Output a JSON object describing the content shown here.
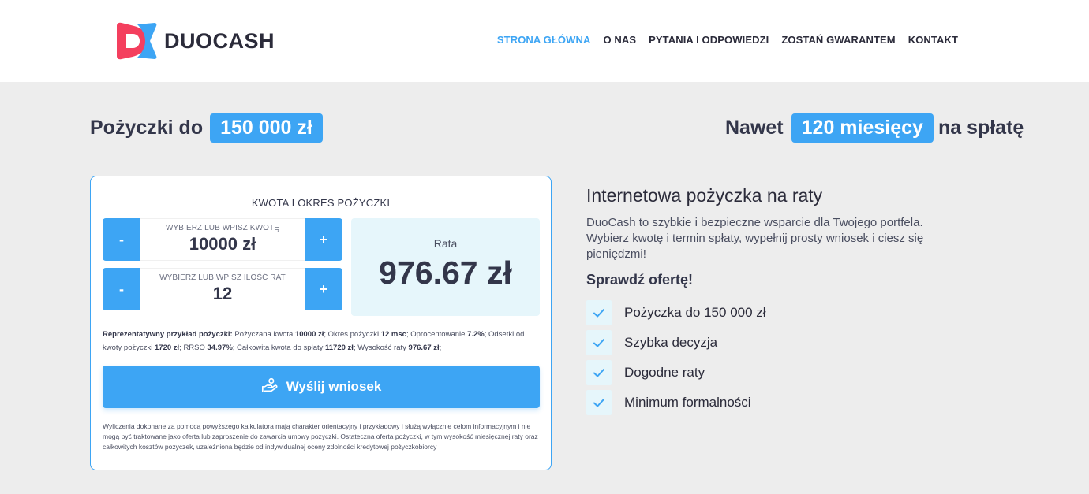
{
  "brand": {
    "name": "DUOCASH",
    "colors": {
      "accent": "#3da5f4",
      "logo_red": "#f43f5e",
      "logo_blue": "#3da5f4"
    }
  },
  "nav": {
    "items": [
      {
        "label": "STRONA GŁÓWNA",
        "active": true
      },
      {
        "label": "O NAS"
      },
      {
        "label": "PYTANIA I ODPOWIEDZI"
      },
      {
        "label": "ZOSTAŃ GWARANTEM"
      },
      {
        "label": "KONTAKT"
      }
    ]
  },
  "headline_left": {
    "prefix": "Pożyczki do",
    "highlight": "150 000 zł"
  },
  "headline_right": {
    "prefix": "Nawet",
    "highlight": "120 miesięcy",
    "suffix": "na spłatę"
  },
  "calculator": {
    "title": "KWOTA I OKRES POŻYCZKI",
    "amount": {
      "label": "WYBIERZ LUB WPISZ KWOTĘ",
      "value": "10000 zł",
      "minus": "-",
      "plus": "+"
    },
    "installments": {
      "label": "WYBIERZ LUB WPISZ ILOŚĆ RAT",
      "value": "12",
      "minus": "-",
      "plus": "+"
    },
    "rate": {
      "label": "Rata",
      "value": "976.67 zł"
    },
    "representative": {
      "lead": "Reprezentatywny przykład pożyczki:",
      "t1": " Pożyczana kwota ",
      "v1": "10000 zł",
      "t2": "; Okres pożyczki ",
      "v2": "12 msc",
      "t3": "; Oprocentowanie ",
      "v3": "7.2%",
      "t4": "; Odsetki od kwoty pożyczki ",
      "v4": "1720 zł",
      "t5": "; RRSO ",
      "v5": "34.97%",
      "t6": "; Całkowita kwota do spłaty ",
      "v6": "11720 zł",
      "t7": "; Wysokość raty ",
      "v7": "976.67 zł",
      "t8": ";"
    },
    "submit_label": "Wyślij wniosek",
    "disclaimer": "Wyliczenia dokonane za pomocą powyższego kalkulatora mają charakter orientacyjny i przykładowy i służą wyłącznie celom informacyjnym i nie mogą być traktowane jako oferta lub zaproszenie do zawarcia umowy pożyczki. Ostateczna oferta pożyczki, w tym wysokość miesięcznej raty oraz całkowitych kosztów pożyczek, uzależniona będzie od indywidualnej oceny zdolności kredytowej pożyczkobiorcy"
  },
  "info": {
    "title": "Internetowa pożyczka na raty",
    "text": "DuoCash to szybkie i bezpieczne wsparcie dla Twojego portfela. Wybierz kwotę i termin spłaty, wypełnij prosty wniosek i ciesz się pieniędzmi!",
    "subtitle": "Sprawdź ofertę!",
    "features": [
      {
        "label": "Pożyczka do 150 000 zł",
        "icon": "check-icon"
      },
      {
        "label": "Szybka decyzja",
        "icon": "check-icon"
      },
      {
        "label": "Dogodne raty",
        "icon": "check-icon"
      },
      {
        "label": "Minimum formalności",
        "icon": "check-icon"
      }
    ]
  }
}
